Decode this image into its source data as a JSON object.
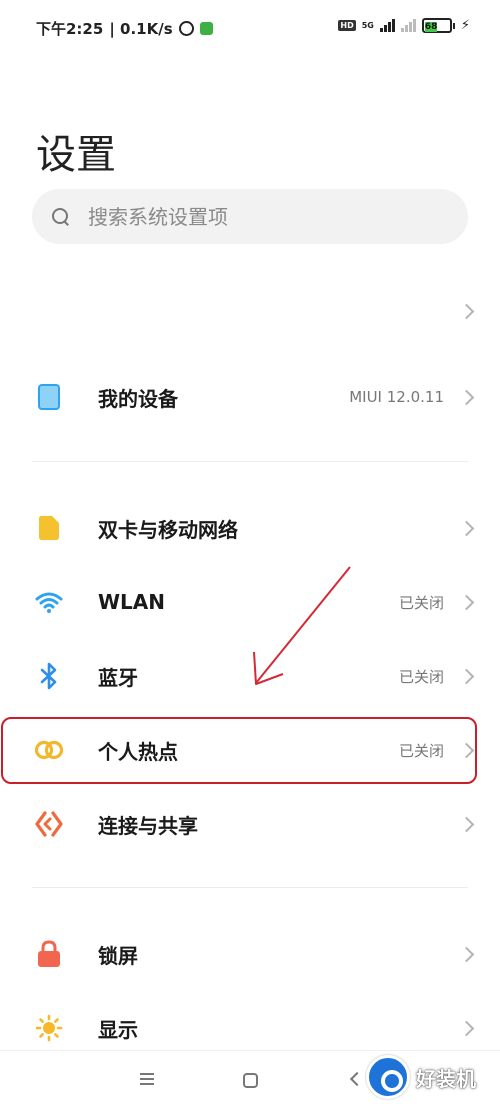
{
  "status_bar": {
    "time": "下午2:25",
    "speed": "| 0.1K/s",
    "network": "5G",
    "battery": "68"
  },
  "header": {
    "title": "设置"
  },
  "search": {
    "placeholder": "搜索系统设置项"
  },
  "items": [
    {
      "key": "account",
      "label": "",
      "value": ""
    },
    {
      "key": "my-device",
      "label": "我的设备",
      "value": "MIUI 12.0.11",
      "icon": "device-icon",
      "color": "#2fa3f0"
    },
    {
      "key": "sim",
      "label": "双卡与移动网络",
      "value": "",
      "icon": "sim-card-icon",
      "color": "#f5c12e"
    },
    {
      "key": "wlan",
      "label": "WLAN",
      "value": "已关闭",
      "icon": "wifi-icon",
      "color": "#2fa3f0"
    },
    {
      "key": "bluetooth",
      "label": "蓝牙",
      "value": "已关闭",
      "icon": "bluetooth-icon",
      "color": "#2f8fe8"
    },
    {
      "key": "hotspot",
      "label": "个人热点",
      "value": "已关闭",
      "icon": "hotspot-icon",
      "color": "#f0b82a"
    },
    {
      "key": "connection",
      "label": "连接与共享",
      "value": "",
      "icon": "share-icon",
      "color": "#f06a3c"
    },
    {
      "key": "lock",
      "label": "锁屏",
      "value": "",
      "icon": "lock-icon",
      "color": "#f2664f"
    },
    {
      "key": "display",
      "label": "显示",
      "value": "",
      "icon": "sun-icon",
      "color": "#f5b92a"
    }
  ],
  "annotation": {
    "highlight_color": "#c8202b"
  },
  "watermark": {
    "text": "好装机"
  }
}
